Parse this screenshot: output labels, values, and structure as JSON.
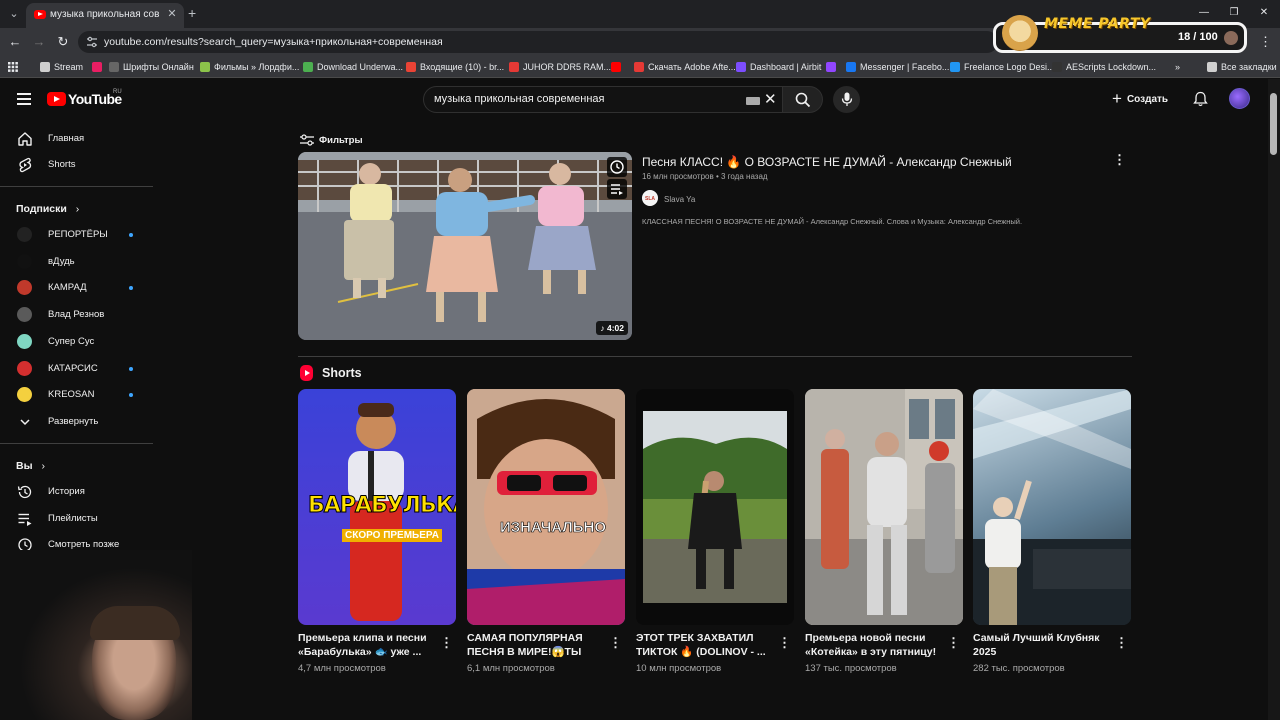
{
  "browser": {
    "tab_title": "музыка прикольная совреме",
    "url": "youtube.com/results?search_query=музыка+прикольная+современная",
    "bookmarks": [
      {
        "label": "Stream",
        "color": "#cfcfcf"
      },
      {
        "label": "",
        "color": "#e91e63"
      },
      {
        "label": "Шрифты Онлайн",
        "color": "#666666"
      },
      {
        "label": "Фильмы » Лордфи...",
        "color": "#8bc34a"
      },
      {
        "label": "Download Underwa...",
        "color": "#4caf50"
      },
      {
        "label": "Входящие (10) - br...",
        "color": "#ea4335"
      },
      {
        "label": "JUHOR DDR5 RAM...",
        "color": "#e53935"
      },
      {
        "label": "",
        "color": "#ff0000"
      },
      {
        "label": "Скачать Adobe Afte...",
        "color": "#e53935"
      },
      {
        "label": "Dashboard | Airbit",
        "color": "#7c4dff"
      },
      {
        "label": "",
        "color": "#9146ff"
      },
      {
        "label": "Messenger | Facebo...",
        "color": "#1877f2"
      },
      {
        "label": "Freelance Logo Desi...",
        "color": "#2196f3"
      },
      {
        "label": "AEScripts Lockdown...",
        "color": "#333333"
      },
      {
        "label": "Все закладки",
        "color": "#cfcfcf"
      }
    ]
  },
  "overlay": {
    "title": "MEME PARTY",
    "counter": "18 / 100"
  },
  "header": {
    "logo": "YouTube",
    "region": "RU",
    "search_value": "музыка прикольная современная",
    "create_label": "Создать"
  },
  "sidebar": {
    "main": [
      {
        "label": "Главная",
        "icon": "home-icon"
      },
      {
        "label": "Shorts",
        "icon": "shorts-icon"
      }
    ],
    "subscriptions_heading": "Подписки",
    "subscriptions": [
      {
        "label": "РЕПОРТЁРЫ",
        "color": "#222222",
        "new": true
      },
      {
        "label": "вДудь",
        "color": "#111111",
        "new": false
      },
      {
        "label": "КАМРАД",
        "color": "#c0392b",
        "new": true
      },
      {
        "label": "Влад Резнов",
        "color": "#5a5a5a",
        "new": false
      },
      {
        "label": "Супер Сус",
        "color": "#7fd6c2",
        "new": false
      },
      {
        "label": "КАТАРСИС",
        "color": "#d32f2f",
        "new": true
      },
      {
        "label": "KREOSAN",
        "color": "#f4d03f",
        "new": true
      }
    ],
    "expand_label": "Развернуть",
    "you_heading": "Вы",
    "you_items": [
      {
        "label": "История",
        "icon": "history-icon"
      },
      {
        "label": "Плейлисты",
        "icon": "playlists-icon"
      },
      {
        "label": "Смотреть позже",
        "icon": "watch-later-icon"
      }
    ]
  },
  "filters_label": "Фильтры",
  "video": {
    "title": "Песня КЛАСС! 🔥 О ВОЗРАСТЕ НЕ ДУМАЙ - Александр Снежный",
    "meta": "16 млн просмотров • 3 года назад",
    "channel": "Slava Ya",
    "description": "КЛАССНАЯ ПЕСНЯ! О ВОЗРАСТЕ НЕ ДУМАЙ - Александр Снежный. Слова и Музыка: Александр Снежный.",
    "duration": "4:02"
  },
  "shorts": {
    "heading": "Shorts",
    "items": [
      {
        "title": "Премьера клипа и песни «Барабулька» 🐟 уже ...",
        "views": "4,7 млн просмотров",
        "overlay_title": "БАРАБУЛЬКА",
        "overlay_sub": "СКОРО ПРЕМЬЕРА"
      },
      {
        "title": "САМАЯ ПОПУЛЯРНАЯ ПЕСНЯ В МИРЕ!😱ТЫ ЕЕ...",
        "views": "6,1 млн просмотров",
        "overlay_title": "ИЗНАЧАЛЬНО",
        "overlay_sub": ""
      },
      {
        "title": "ЭТОТ ТРЕК ЗАХВАТИЛ ТИКТОК 🔥 (DOLINOV - ...",
        "views": "10 млн просмотров",
        "overlay_title": "",
        "overlay_sub": ""
      },
      {
        "title": "Премьера новой песни «Котейка» в эту пятницу!",
        "views": "137 тыс. просмотров",
        "overlay_title": "",
        "overlay_sub": ""
      },
      {
        "title": "Самый Лучший Клубняк 2025",
        "views": "282 тыс. просмотров",
        "overlay_title": "",
        "overlay_sub": ""
      }
    ]
  }
}
